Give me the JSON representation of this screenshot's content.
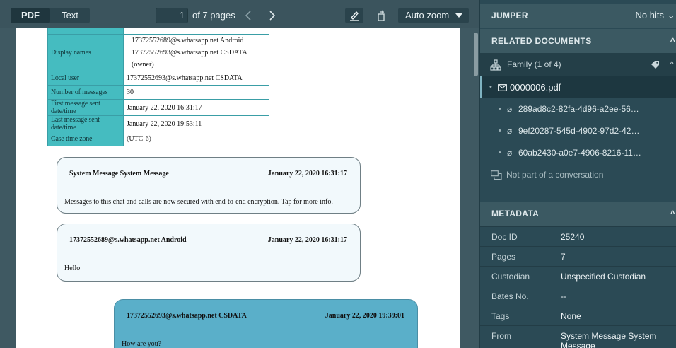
{
  "toolbar": {
    "tabs": [
      {
        "label": "PDF"
      },
      {
        "label": "Text"
      }
    ],
    "page_current": "1",
    "page_of": "of 7 pages",
    "zoom_label": "Auto zoom",
    "icons": [
      "chevron-left-icon",
      "chevron-right-icon",
      "highlighter-icon",
      "rotate-icon",
      "caret-down-icon"
    ]
  },
  "document": {
    "table_rows": [
      {
        "label": "",
        "value": ""
      },
      {
        "label": "Display names",
        "value_lines": [
          "17372552689@s.whatsapp.net Android",
          "17372552693@s.whatsapp.net CSDATA (owner)"
        ]
      },
      {
        "label": "Local user",
        "value": "17372552693@s.whatsapp.net CSDATA"
      },
      {
        "label": "Number of messages",
        "value": "30"
      },
      {
        "label": "First message sent date/time",
        "value": "January 22, 2020 16:31:17"
      },
      {
        "label": "Last message sent date/time",
        "value": "January 22, 2020 19:53:11"
      },
      {
        "label": "Case time zone",
        "value": "(UTC-6)"
      }
    ],
    "messages": [
      {
        "sender": "System Message System Message",
        "date": "January 22, 2020 16:31:17",
        "body": "Messages to this chat and calls are now secured with end-to-end encryption. Tap for more info."
      },
      {
        "sender": "17372552689@s.whatsapp.net Android",
        "date": "January 22, 2020 16:31:17",
        "body": "Hello"
      },
      {
        "sender": "17372552693@s.whatsapp.net CSDATA",
        "date": "January 22, 2020 19:39:01",
        "body": "How are you?"
      }
    ]
  },
  "side_panel": {
    "jumper": {
      "title": "JUMPER",
      "status": "No hits"
    },
    "related": {
      "title": "RELATED DOCUMENTS",
      "family_label": "Family (1 of 4)",
      "selected_doc": "0000006.pdf",
      "attachments": [
        "289ad8c2-82fa-4d96-a2ee-56…",
        "9ef20287-545d-4902-97d2-42…",
        "60ab2430-a0e7-4906-8216-11…"
      ],
      "conversation": "Not part of a conversation"
    },
    "metadata": {
      "title": "METADATA",
      "rows": [
        {
          "key": "Doc ID",
          "value": "25240"
        },
        {
          "key": "Pages",
          "value": "7"
        },
        {
          "key": "Custodian",
          "value": "Unspecified Custodian"
        },
        {
          "key": "Bates No.",
          "value": "--"
        },
        {
          "key": "Tags",
          "value": "None"
        },
        {
          "key": "From",
          "value": "System Message System Message"
        }
      ]
    }
  },
  "colors": {
    "table_header": "#45bcc0",
    "own_message": "#5aafc9",
    "other_message": "#f2f9fc",
    "panel_bg": "#2b4a55"
  }
}
